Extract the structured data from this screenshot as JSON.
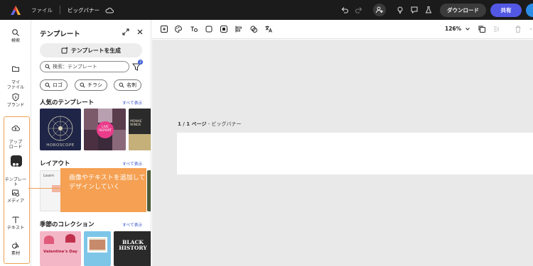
{
  "topbar": {
    "file_label": "ファイル",
    "doc_title": "ビッグバナー",
    "download_label": "ダウンロード",
    "share_label": "共有"
  },
  "rail": [
    {
      "key": "search",
      "label": "検索"
    },
    {
      "key": "myfiles",
      "label": "マイ\nファイル"
    },
    {
      "key": "brand",
      "label": "ブランド"
    },
    {
      "key": "upload",
      "label": "アップ\nロード"
    },
    {
      "key": "templates",
      "label": "テンプレー\nト"
    },
    {
      "key": "media",
      "label": "メディア"
    },
    {
      "key": "text",
      "label": "テキスト"
    },
    {
      "key": "elements",
      "label": "素材"
    }
  ],
  "panel": {
    "title": "テンプレート",
    "generate_label": "テンプレートを生成",
    "search_placeholder": "検索：テンプレート",
    "filter_count": "2",
    "chips": [
      "ロゴ",
      "チラシ",
      "名刺"
    ],
    "sections": [
      {
        "title": "人気のテンプレート",
        "link": "すべて表示"
      },
      {
        "title": "レイアウト",
        "link": "すべて表示"
      },
      {
        "title": "季節のコレクション",
        "link": "すべて表示"
      }
    ],
    "thumb_texts": {
      "horoscope": "HOROSCOPE",
      "live_report": "LIVE REPORT",
      "monae_winde": "MONAE WINDE",
      "learn": "Learn",
      "valentines": "Valentine's Day",
      "black_history": "BLACK HISTORY"
    }
  },
  "toolbar": {
    "zoom": "126%"
  },
  "canvas": {
    "page_number": "1 / 1 ページ",
    "page_name": "ビッグバナー"
  },
  "callout": {
    "text": "画像やテキストを追加してデザインしていく"
  },
  "colors": {
    "topbar": "#1b1b1b",
    "share": "#5258e4",
    "callout": "#f5a052",
    "canvas": "#e9e9e9"
  }
}
